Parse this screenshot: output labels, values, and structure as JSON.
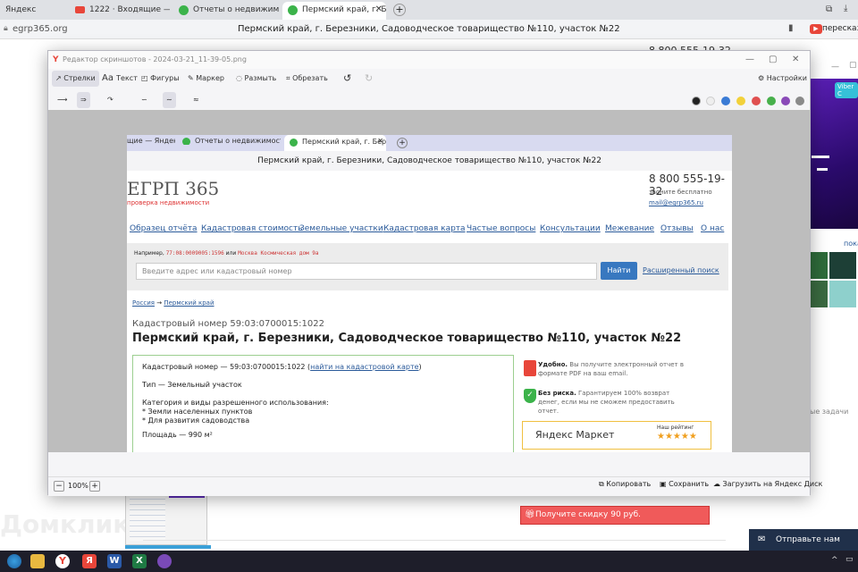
{
  "browser": {
    "tabs": [
      {
        "label": "Яндекс",
        "color": ""
      },
      {
        "label": "1222 · Входящие — Яндекс",
        "color": "#e8463a"
      },
      {
        "label": "Отчеты о недвижимости",
        "color": "#3bb34a"
      },
      {
        "label": "Пермский край, г. Берез",
        "color": "#3bb34a"
      }
    ],
    "address_domain": "egrp365.org",
    "address_title": "Пермский край, г. Березники, Садоводческое товарищество №110, участок №22",
    "right_button": "пересказать",
    "phone_top": "8 800 555-19-32",
    "viber_btn": "Viber C",
    "right_link": "пока",
    "right_text": "ые задачи",
    "watermark": "Домклик",
    "discount": "Получите скидку 90 руб.",
    "notify": "Отправьте нам сообщ"
  },
  "editor": {
    "title": "Редактор скриншотов - 2024-03-21_11-39-05.png",
    "tools": {
      "arrows": "Стрелки",
      "text": "Текст",
      "shapes": "Фигуры",
      "marker": "Маркер",
      "blur": "Размыть",
      "crop": "Обрезать",
      "settings": "Настройки"
    },
    "colors": [
      "#222222",
      "#eeeeee",
      "#3a7bd5",
      "#f2d13a",
      "#e05050",
      "#47b04b",
      "#8a4ab8",
      "#8a8a8a"
    ],
    "zoom": "100%",
    "bottom": {
      "copy": "Копировать",
      "save": "Сохранить",
      "upload": "Загрузить на Яндекс Диск"
    }
  },
  "shot": {
    "tabs": [
      "щие — Яндек",
      "Отчеты о недвижимости",
      "Пермский край, г. Бере"
    ],
    "address": "Пермский край, г. Березники, Садоводческое товарищество №110, участок №22",
    "logo": "ЕГРП 365",
    "logo_sub": "проверка недвижимости",
    "phone": "8 800 555-19-32",
    "phone_note": "звоните бесплатно",
    "email": "mail@egrp365.ru",
    "nav": [
      "Образец отчёта",
      "Кадастровая стоимость",
      "Земельные участки",
      "Кадастровая карта",
      "Частые вопросы",
      "Консультации",
      "Межевание",
      "Отзывы",
      "О нас"
    ],
    "example_label": "Например,",
    "example_code": "77:08:0009005:1596",
    "example_or": "или",
    "example_addr": "Москва Космическая дом 9а",
    "search_placeholder": "Введите адрес или кадастровый номер",
    "search_button": "Найти",
    "advanced_search": "Расширенный поиск",
    "breadcrumb_1": "Россия",
    "breadcrumb_arrow": "→",
    "breadcrumb_2": "Пермский край",
    "cad_heading": "Кадастровый номер 59:03:0700015:1022",
    "page_title": "Пермский край, г. Березники, Садоводческое товарищество №110, участок №22",
    "info": {
      "cad_line": "Кадастровый номер — 59:03:0700015:1022 (",
      "cad_link": "найти на кадастровой карте",
      "cad_close": ")",
      "type": "Тип — Земельный участок",
      "category_label": "Категория и виды разрешенного использования:",
      "category_1": "* Земли населенных пунктов",
      "category_2": "* Для развития садоводства",
      "area": "Площадь — 990 м²"
    },
    "benefit_1_bold": "Удобно.",
    "benefit_1": "Вы получите электронный отчет в формате PDF на ваш email.",
    "benefit_2_bold": "Без риска.",
    "benefit_2": "Гарантируем 100% возврат денег, если мы не сможем предоставить отчет.",
    "market": "Яндекс Маркет",
    "rating_label": "Наш рейтинг",
    "stars": "★★★★★"
  }
}
